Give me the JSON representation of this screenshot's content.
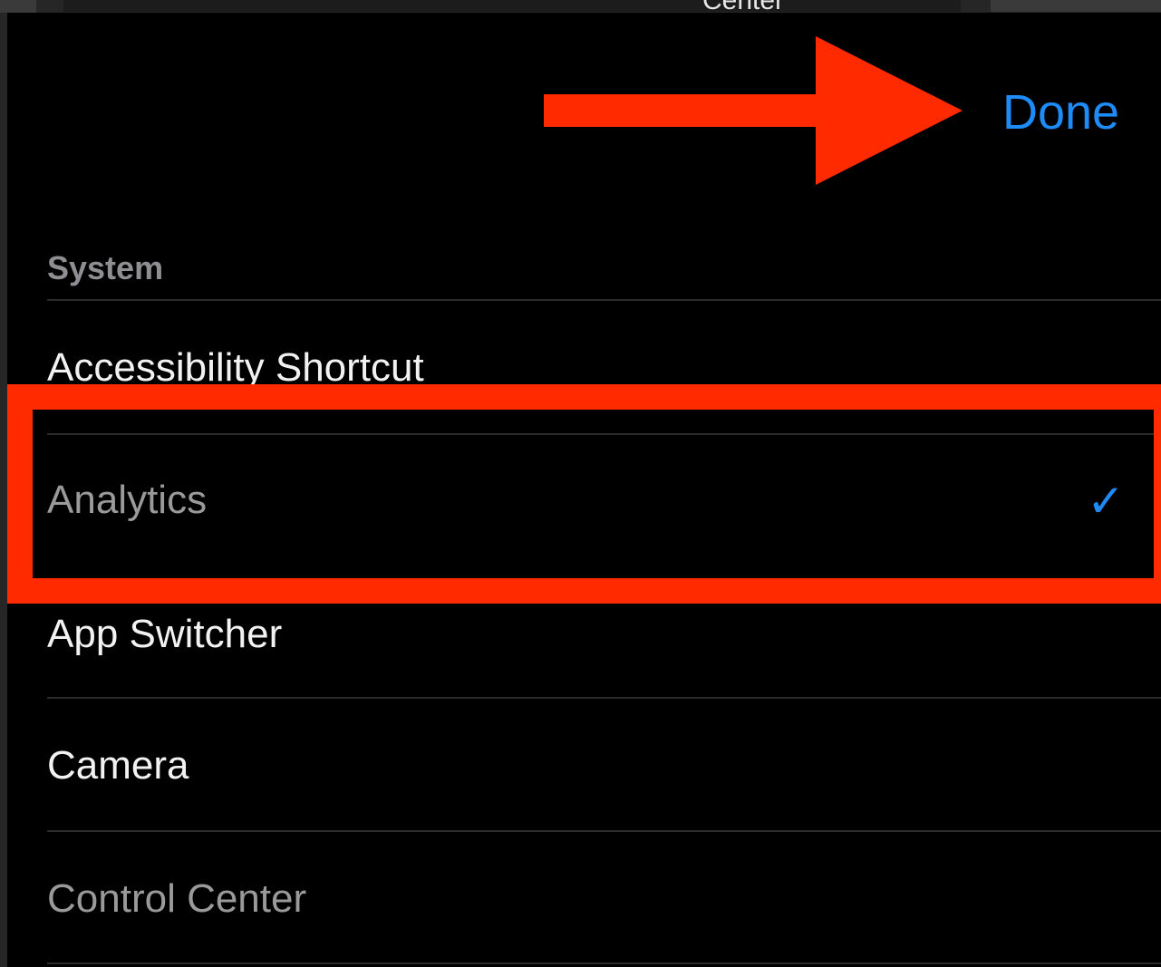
{
  "top_bar": {
    "label": "Center"
  },
  "nav": {
    "done_label": "Done"
  },
  "section": {
    "header": "System"
  },
  "rows": [
    {
      "label": "Accessibility Shortcut",
      "selected": false,
      "dim": false
    },
    {
      "label": "Analytics",
      "selected": true,
      "dim": true
    },
    {
      "label": "App Switcher",
      "selected": false,
      "dim": false
    },
    {
      "label": "Camera",
      "selected": false,
      "dim": false
    },
    {
      "label": "Control Center",
      "selected": false,
      "dim": true
    }
  ],
  "checkmark_glyph": "✓",
  "colors": {
    "accent": "#1d8cf8",
    "annotation": "#ff2a00",
    "background": "#000000",
    "text": "#f2f2f2",
    "dim_text": "#9a9a9a",
    "header_text": "#8e8e93"
  },
  "icons": {
    "annotation_arrow": "arrow-right-icon",
    "selected_indicator": "checkmark-icon"
  }
}
